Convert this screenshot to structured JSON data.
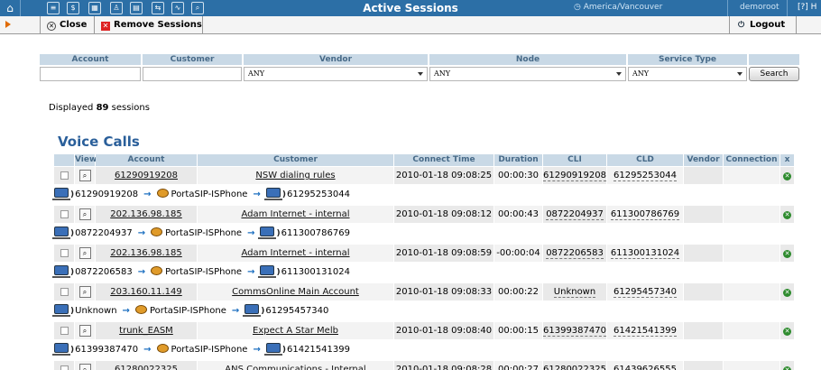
{
  "topbar": {
    "title": "Active Sessions",
    "timezone": "America/Vancouver",
    "user": "demoroot",
    "help": "?",
    "timezone_icon": "clock-icon"
  },
  "toolbar": {
    "close_label": "Close",
    "remove_label": "Remove Sessions",
    "logout_label": "Logout"
  },
  "filter": {
    "headers": [
      "Account",
      "Customer",
      "Vendor",
      "Node",
      "Service Type"
    ],
    "vendor_value": "ANY",
    "node_value": "ANY",
    "service_value": "ANY",
    "search_label": "Search"
  },
  "status": {
    "prefix": "Displayed",
    "count": "89",
    "suffix": "sessions"
  },
  "section_title": "Voice Calls",
  "table": {
    "headers": [
      "View",
      "Account",
      "Customer",
      "Connect Time",
      "Duration",
      "CLI",
      "CLD",
      "Vendor",
      "Connection",
      "x"
    ],
    "rows": [
      {
        "account": "61290919208",
        "customer": "NSW dialing rules",
        "connect_time": "2010-01-18 09:08:25",
        "duration": "00:00:30",
        "cli": "61290919208",
        "cld": "61295253044",
        "route": {
          "from": "61290919208",
          "via": "PortaSIP-ISPhone",
          "to": "61295253044"
        }
      },
      {
        "account": "202.136.98.185",
        "customer": "Adam Internet - internal",
        "connect_time": "2010-01-18 09:08:12",
        "duration": "00:00:43",
        "cli": "0872204937",
        "cld": "611300786769",
        "route": {
          "from": "0872204937",
          "via": "PortaSIP-ISPhone",
          "to": "611300786769"
        }
      },
      {
        "account": "202.136.98.185",
        "customer": "Adam Internet - internal",
        "connect_time": "2010-01-18 09:08:59",
        "duration": "-00:00:04",
        "cli": "0872206583",
        "cld": "611300131024",
        "route": {
          "from": "0872206583",
          "via": "PortaSIP-ISPhone",
          "to": "611300131024"
        }
      },
      {
        "account": "203.160.11.149",
        "customer": "CommsOnline Main Account",
        "connect_time": "2010-01-18 09:08:33",
        "duration": "00:00:22",
        "cli": "Unknown",
        "cld": "61295457340",
        "route": {
          "from": "Unknown",
          "via": "PortaSIP-ISPhone",
          "to": "61295457340"
        }
      },
      {
        "account": "trunk_EASM",
        "customer": "Expect A Star Melb",
        "connect_time": "2010-01-18 09:08:40",
        "duration": "00:00:15",
        "cli": "61399387470",
        "cld": "61421541399",
        "route": {
          "from": "61399387470",
          "via": "PortaSIP-ISPhone",
          "to": "61421541399"
        }
      },
      {
        "account": "61280022325",
        "customer": "ANS Communications - Internal",
        "connect_time": "2010-01-18 09:08:28",
        "duration": "00:00:27",
        "cli": "61280022325",
        "cld": "61439626555"
      }
    ]
  }
}
